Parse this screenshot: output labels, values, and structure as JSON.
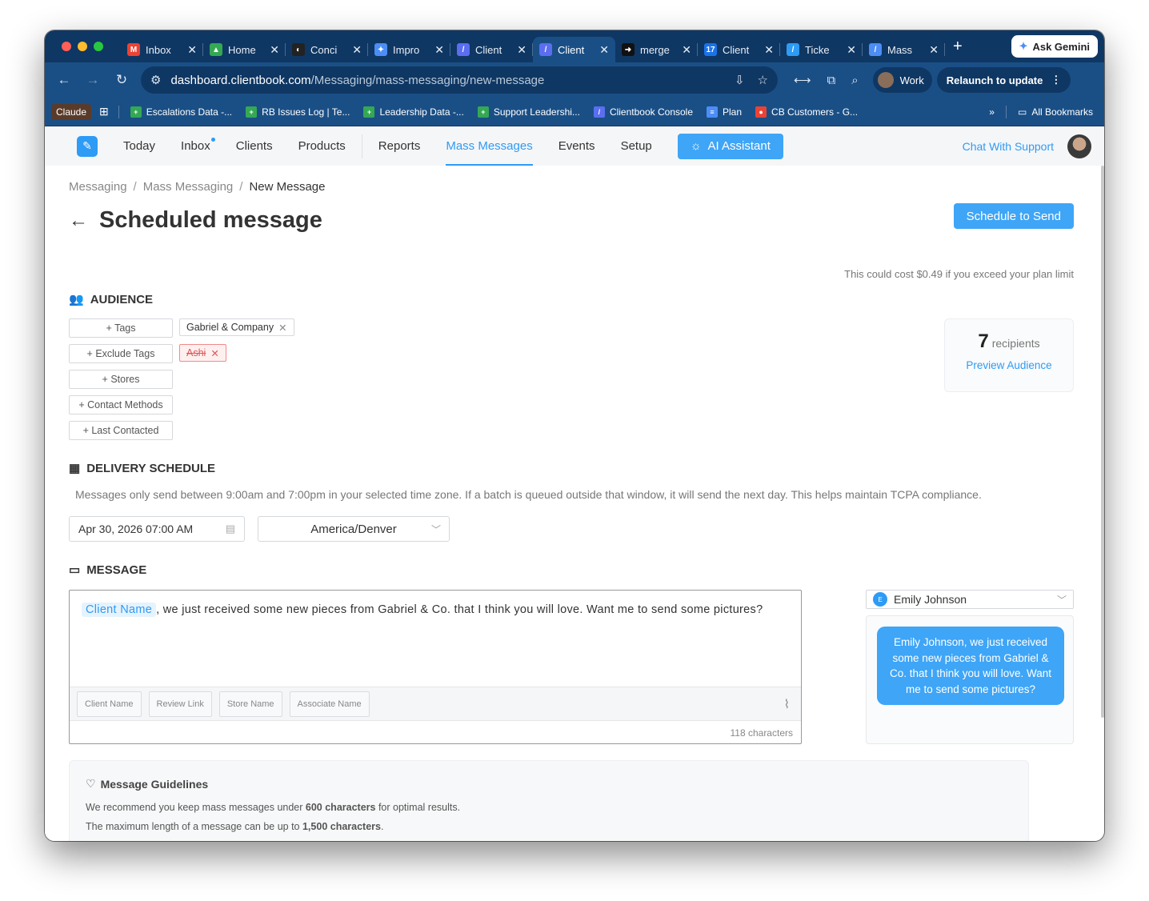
{
  "browser": {
    "tabs": [
      {
        "title": "Inbox",
        "icon": "gmail-icon",
        "color": "#ea4335",
        "glyph": "M"
      },
      {
        "title": "Home",
        "icon": "drive-icon",
        "color": "#34a853",
        "glyph": "▲"
      },
      {
        "title": "Conci",
        "icon": "concierge-icon",
        "color": "#222222",
        "glyph": "◐"
      },
      {
        "title": "Impro",
        "icon": "gemini-icon",
        "color": "#4c8df6",
        "glyph": "✦"
      },
      {
        "title": "Client",
        "icon": "clientbook-icon",
        "color": "#5b6ef0",
        "glyph": "/"
      },
      {
        "title": "Client",
        "icon": "clientbook-icon",
        "color": "#5b6ef0",
        "glyph": "/",
        "active": true
      },
      {
        "title": "merge",
        "icon": "arrow-icon",
        "color": "#111111",
        "glyph": "➜"
      },
      {
        "title": "Client",
        "icon": "calendar-icon",
        "color": "#1a73e8",
        "glyph": "17"
      },
      {
        "title": "Ticke",
        "icon": "ticket-icon",
        "color": "#2e9bf5",
        "glyph": "/"
      },
      {
        "title": "Mass",
        "icon": "clientbook-icon",
        "color": "#4c8df6",
        "glyph": "/"
      }
    ],
    "ask_gemini": "Ask Gemini",
    "url_host": "dashboard.clientbook.com",
    "url_path": "/Messaging/mass-messaging/new-message",
    "profile": "Work",
    "relaunch": "Relaunch to update",
    "bookmarks": [
      {
        "label": "Escalations Data -...",
        "color": "#34a853",
        "glyph": "+"
      },
      {
        "label": "RB Issues Log | Te...",
        "color": "#34a853",
        "glyph": "+"
      },
      {
        "label": "Leadership Data -...",
        "color": "#34a853",
        "glyph": "+"
      },
      {
        "label": "Support Leadershi...",
        "color": "#34a853",
        "glyph": "+"
      },
      {
        "label": "Clientbook Console",
        "color": "#5b6ef0",
        "glyph": "/"
      },
      {
        "label": "Plan",
        "color": "#4c8df6",
        "glyph": "≡"
      },
      {
        "label": "CB Customers - G...",
        "color": "#ea4335",
        "glyph": "●"
      }
    ],
    "claude": "Claude",
    "all_bookmarks": "All Bookmarks"
  },
  "nav": {
    "items": [
      {
        "label": "Today"
      },
      {
        "label": "Inbox",
        "dot": true
      },
      {
        "label": "Clients"
      },
      {
        "label": "Products"
      },
      {
        "label": "Reports"
      },
      {
        "label": "Mass Messages",
        "active": true
      },
      {
        "label": "Events"
      },
      {
        "label": "Setup"
      }
    ],
    "ai_assistant": "AI Assistant",
    "chat_support": "Chat With Support"
  },
  "page": {
    "breadcrumb": [
      "Messaging",
      "Mass Messaging",
      "New Message"
    ],
    "title": "Scheduled message",
    "schedule_button": "Schedule to Send",
    "cost_note": "This could cost $0.49 if you exceed your plan limit"
  },
  "audience": {
    "heading": "AUDIENCE",
    "filters": [
      "+ Tags",
      "+ Exclude Tags",
      "+ Stores",
      "+ Contact Methods",
      "+ Last Contacted"
    ],
    "tag_chip": "Gabriel & Company",
    "exclude_chip": "Ashi",
    "recipients_count": "7",
    "recipients_label": "recipients",
    "preview_audience": "Preview Audience"
  },
  "delivery": {
    "heading": "DELIVERY SCHEDULE",
    "notice": "Messages only send between 9:00am and 7:00pm in your selected time zone. If a batch is queued outside that window, it will send the next day. This helps maintain TCPA compliance.",
    "date_value": "Apr 30, 2026 07:00 AM",
    "timezone": "America/Denver"
  },
  "message": {
    "heading": "MESSAGE",
    "token": "Client Name",
    "body": ", we just received some new pieces from Gabriel & Co. that I think you will love. Want me to send some pictures?",
    "token_buttons": [
      "Client Name",
      "Review Link",
      "Store Name",
      "Associate Name"
    ],
    "char_count": "118 characters",
    "preview_recipient": "Emily Johnson",
    "preview_avatar": "E",
    "preview_text": "Emily Johnson, we just received some new pieces from Gabriel & Co. that I think you will love. Want me to send some pictures?"
  },
  "guidelines": {
    "heading": "Message Guidelines",
    "line1_pre": "We recommend you keep mass messages under ",
    "line1_bold": "600 characters",
    "line1_post": " for optimal results.",
    "line2_pre": "The maximum length of a message can be up to ",
    "line2_bold": "1,500 characters",
    "line2_post": "."
  },
  "colors": {
    "accent": "#2e9bf5",
    "chrome": "#1a4f86",
    "chrome_dark": "#0f3763",
    "exclude": "#e05555"
  }
}
